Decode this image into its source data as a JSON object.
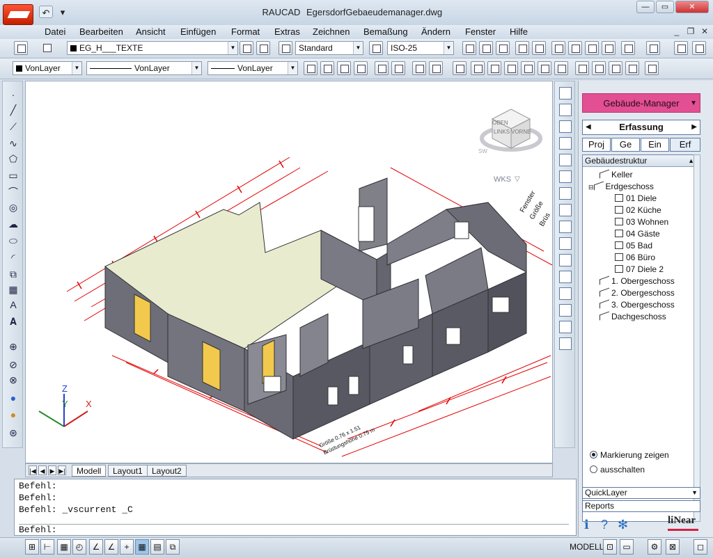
{
  "window": {
    "app_name": "RAUCAD",
    "file_name": "EgersdorfGebaeudemanager.dwg",
    "qat_undo": "↶",
    "qat_more": "▾",
    "minimize": "—",
    "restore": "▭",
    "close": "✕"
  },
  "menu": {
    "items": [
      "Datei",
      "Bearbeiten",
      "Ansicht",
      "Einfügen",
      "Format",
      "Extras",
      "Zeichnen",
      "Bemaßung",
      "Ändern",
      "Fenster",
      "Hilfe"
    ],
    "doc_minimize": "_",
    "doc_restore": "❐",
    "doc_close": "✕"
  },
  "toolbar1": {
    "layer_value": "EG_H___TEXTE",
    "text_style": "Standard",
    "dim_style": "ISO-25"
  },
  "toolbar2": {
    "color": "VonLayer",
    "linetype": "VonLayer",
    "lineweight": "VonLayer"
  },
  "viewcube": {
    "top": "OBEN",
    "left": "LINKS",
    "front": "VORNE",
    "compass": "SW",
    "wcs": "WKS",
    "wcs_arrow": "▽"
  },
  "drawing_notes": {
    "note1": "Fenster",
    "note2": "Größe",
    "note3": "Brüs",
    "room_label1": "Größe 0.76 x 1.51",
    "room_label2": "Brüstungshöhe 0.75 m"
  },
  "ucs": {
    "x": "X",
    "y": "Y",
    "z": "Z"
  },
  "layout_tabs": [
    "Modell",
    "Layout1",
    "Layout2"
  ],
  "tab_nav": [
    "|◀",
    "◀",
    "▶",
    "▶|"
  ],
  "command": {
    "lines": [
      "Befehl:",
      "Befehl:",
      "Befehl: _vscurrent _C"
    ],
    "prompt": "Befehl:"
  },
  "status": {
    "model": "MODELL"
  },
  "panel": {
    "manager_title": "Gebäude-Manager",
    "manager_arrow": "▼",
    "section": "Erfassung",
    "sec_prev": "◀",
    "sec_next": "▶",
    "tabs": [
      "Proj",
      "Ge",
      "Ein",
      "Erf"
    ],
    "tree_header": "Gebäudestruktur",
    "tree_scroll_up": "▲",
    "tree": [
      {
        "label": "Keller",
        "level": 0
      },
      {
        "label": "Erdgeschoss",
        "level": 0,
        "expanded": true
      },
      {
        "label": "01 Diele",
        "level": 1
      },
      {
        "label": "02 Küche",
        "level": 1
      },
      {
        "label": "03 Wohnen",
        "level": 1
      },
      {
        "label": "04 Gäste",
        "level": 1
      },
      {
        "label": "05 Bad",
        "level": 1
      },
      {
        "label": "06 Büro",
        "level": 1
      },
      {
        "label": "07 Diele 2",
        "level": 1
      },
      {
        "label": "1. Obergeschoss",
        "level": 0
      },
      {
        "label": "2. Obergeschoss",
        "level": 0
      },
      {
        "label": "3. Obergeschoss",
        "level": 0
      },
      {
        "label": "Dachgeschoss",
        "level": 0
      }
    ],
    "radio_show": "Markierung zeigen",
    "radio_off": "ausschalten",
    "quicklayer": "QuickLayer",
    "reports": "Reports",
    "logo": "liNear"
  },
  "colors": {
    "accent_pink": "#e24f93",
    "dim_red": "#e30000",
    "wall_gray": "#6e6e78",
    "floor": "#e9ebcf",
    "door_yellow": "#f2c94c"
  }
}
